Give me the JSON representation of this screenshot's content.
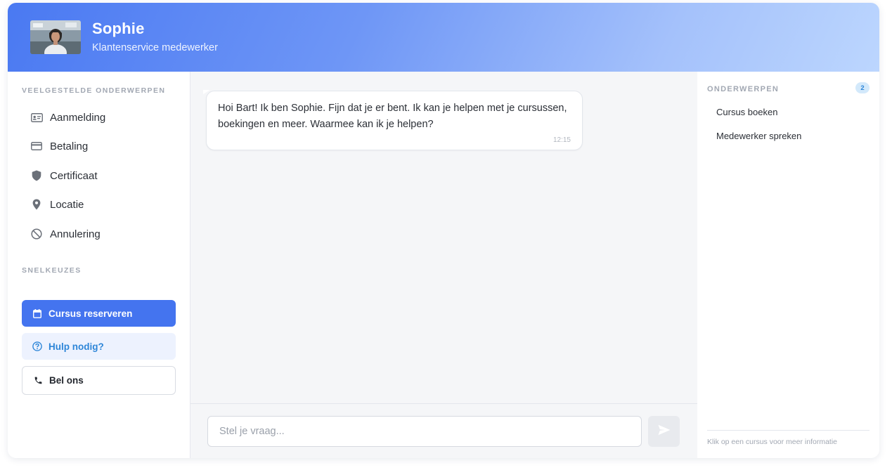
{
  "header": {
    "agent_name": "Sophie",
    "agent_role": "Klantenservice medewerker",
    "gradient_start": "#4a79f2",
    "gradient_end": "#bcd6fe"
  },
  "sidebar": {
    "topics_title": "VEELGESTELDE ONDERWERPEN",
    "topics": [
      {
        "label": "Aanmelding",
        "icon": "id-card-icon"
      },
      {
        "label": "Betaling",
        "icon": "credit-card-icon"
      },
      {
        "label": "Certificaat",
        "icon": "shield-icon"
      },
      {
        "label": "Locatie",
        "icon": "location-pin-icon"
      },
      {
        "label": "Annulering",
        "icon": "block-icon"
      }
    ],
    "quick_title": "SNELKEUZES",
    "quick": [
      {
        "label": "Cursus reserveren",
        "icon": "calendar-icon"
      },
      {
        "label": "Hulp nodig?",
        "icon": "help-circle-icon"
      },
      {
        "label": "Bel ons",
        "icon": "phone-icon"
      }
    ]
  },
  "chat": {
    "messages": [
      {
        "text": "Hoi Bart! Ik ben Sophie. Fijn dat je er bent. Ik kan je helpen met je cursussen, boekingen en meer. Waarmee kan ik je helpen?",
        "time": "12:15"
      }
    ],
    "input_placeholder": "Stel je vraag...",
    "input_value": "",
    "send_icon": "send-icon"
  },
  "right_panel": {
    "title": "ONDERWERPEN",
    "count": "2",
    "items": [
      "Cursus boeken",
      "Medewerker spreken"
    ],
    "hint": "Klik op een cursus voor meer informatie"
  },
  "colors": {
    "accent": "#4474ef",
    "help_bg": "#edf2fe",
    "help_text": "#2e86d8"
  }
}
